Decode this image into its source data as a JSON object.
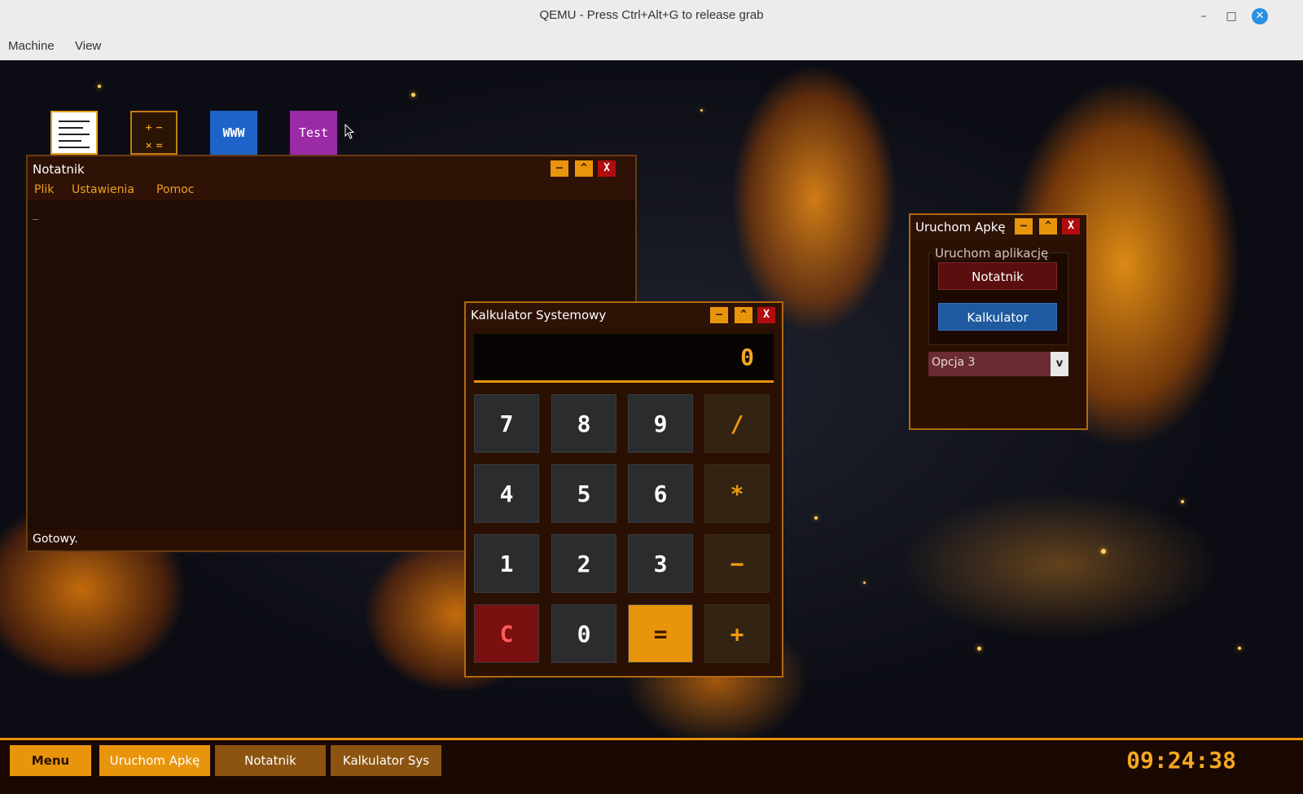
{
  "host": {
    "title": "QEMU - Press Ctrl+Alt+G to release grab",
    "menu": [
      "Machine",
      "View"
    ],
    "controls": {
      "minimize": "–",
      "maximize": "□",
      "close": "✕"
    }
  },
  "desktop_icons": {
    "notatnik": {
      "icon": "document-lines-icon"
    },
    "kalkulator": {
      "icon": "calculator-icon",
      "glyphs": [
        "+ −",
        "× ="
      ]
    },
    "www": {
      "label": "WWW"
    },
    "test": {
      "label": "Test"
    }
  },
  "notepad": {
    "title": "Notatnik",
    "menu": [
      "Plik",
      "Ustawienia",
      "Pomoc"
    ],
    "content": "_",
    "status": "Gotowy.",
    "buttons": {
      "minimize": "–",
      "maximize": "^",
      "close": "X"
    }
  },
  "calculator": {
    "title": "Kalkulator Systemowy",
    "display": "0",
    "buttons": {
      "minimize": "–",
      "maximize": "^",
      "close": "X"
    },
    "keys": [
      [
        "7",
        "8",
        "9",
        "/"
      ],
      [
        "4",
        "5",
        "6",
        "*"
      ],
      [
        "1",
        "2",
        "3",
        "−"
      ],
      [
        "C",
        "0",
        "=",
        "+"
      ]
    ]
  },
  "launcher": {
    "title": "Uruchom Apkę",
    "group_title": "Uruchom aplikację",
    "buttons_labels": {
      "notatnik": "Notatnik",
      "kalkulator": "Kalkulator"
    },
    "select": {
      "value": "Opcja 3",
      "arrow": "v"
    },
    "buttons": {
      "minimize": "–",
      "maximize": "^",
      "close": "X"
    }
  },
  "taskbar": {
    "menu": "Menu",
    "items": [
      "Uruchom Apkę",
      "Notatnik",
      "Kalkulator Sys"
    ],
    "clock": "09:24:38"
  },
  "colors": {
    "accent": "#e8950c",
    "close": "#b00d10",
    "window_bg": "#2a1003"
  }
}
